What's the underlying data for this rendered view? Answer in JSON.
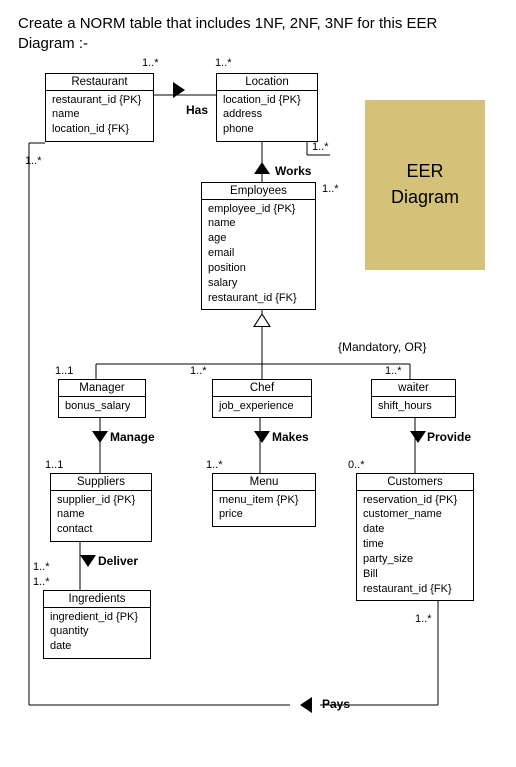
{
  "question": "Create a NORM table that includes 1NF, 2NF, 3NF for this EER Diagram :-",
  "diagram_label": "EER\nDiagram",
  "entities": {
    "restaurant": {
      "title": "Restaurant",
      "attrs": [
        "restaurant_id {PK}",
        "name",
        "location_id {FK}"
      ]
    },
    "location": {
      "title": "Location",
      "attrs": [
        "location_id {PK}",
        "address",
        "phone"
      ]
    },
    "employees": {
      "title": "Employees",
      "attrs": [
        "employee_id {PK}",
        "name",
        "age",
        "email",
        "position",
        "salary",
        "restaurant_id {FK}"
      ]
    },
    "manager": {
      "title": "Manager",
      "attrs": [
        "bonus_salary"
      ]
    },
    "chef": {
      "title": "Chef",
      "attrs": [
        "job_experience"
      ]
    },
    "waiter": {
      "title": "waiter",
      "attrs": [
        "shift_hours"
      ]
    },
    "suppliers": {
      "title": "Suppliers",
      "attrs": [
        "supplier_id {PK}",
        "name",
        "contact"
      ]
    },
    "menu": {
      "title": "Menu",
      "attrs": [
        "menu_item {PK}",
        "price"
      ]
    },
    "customers": {
      "title": "Customers",
      "attrs": [
        "reservation_id {PK}",
        "customer_name",
        "date",
        "time",
        "party_size",
        "Bill",
        "restaurant_id {FK}"
      ]
    },
    "ingredients": {
      "title": "Ingredients",
      "attrs": [
        "ingredient_id {PK}",
        "quantity",
        "date"
      ]
    }
  },
  "relationships": {
    "has": "Has",
    "works": "Works",
    "manage": "Manage",
    "makes": "Makes",
    "provide": "Provide",
    "deliver": "Deliver",
    "pays": "Pays"
  },
  "constraint": "{Mandatory, OR}",
  "cards": {
    "rest_top": "1..*",
    "loc_top": "1..*",
    "rest_left": "1..*",
    "loc_right": "1..*",
    "emp_right": "1..*",
    "mgr_top": "1..1",
    "chef_top": "1..*",
    "waiter_top": "1..*",
    "sup_top": "1..1",
    "menu_top": "1..*",
    "cust_top": "0..*",
    "ing_top1": "1..*",
    "ing_top2": "1..*",
    "cust_bottom": "1..*"
  }
}
